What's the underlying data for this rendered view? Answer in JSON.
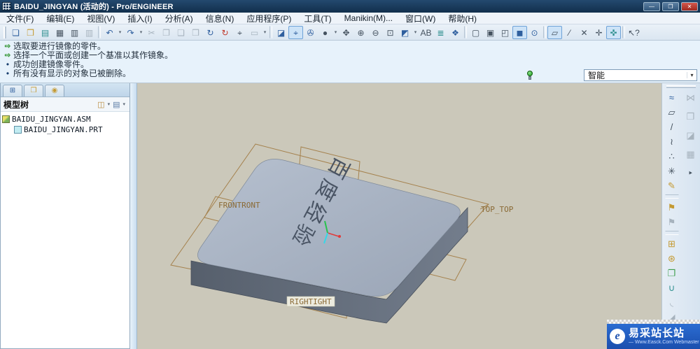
{
  "window": {
    "title": "BAIDU_JINGYAN (活动的) - Pro/ENGINEER",
    "controls": {
      "minimize": "—",
      "restore": "❐",
      "close": "✕"
    }
  },
  "menu": {
    "items": [
      {
        "label": "文件(F)"
      },
      {
        "label": "编辑(E)"
      },
      {
        "label": "视图(V)"
      },
      {
        "label": "插入(I)"
      },
      {
        "label": "分析(A)"
      },
      {
        "label": "信息(N)"
      },
      {
        "label": "应用程序(P)"
      },
      {
        "label": "工具(T)"
      },
      {
        "label": "Manikin(M)..."
      },
      {
        "label": "窗口(W)"
      },
      {
        "label": "帮助(H)"
      }
    ]
  },
  "toolbar": {
    "items": [
      {
        "name": "new-file-icon",
        "glyph": "❏",
        "cls": "t-blue"
      },
      {
        "name": "open-file-icon",
        "glyph": "❒",
        "cls": "t-yellow"
      },
      {
        "name": "save-icon",
        "glyph": "▤",
        "cls": "t-teal"
      },
      {
        "name": "print-icon",
        "glyph": "▦",
        "cls": "t-dark"
      },
      {
        "name": "print-drawing-icon",
        "glyph": "▥",
        "cls": "t-dark"
      },
      {
        "name": "send-model-icon",
        "glyph": "▥",
        "cls": "t-gray"
      },
      {
        "name": "separator",
        "glyph": "",
        "cls": "sep"
      },
      {
        "name": "undo-icon",
        "glyph": "↶",
        "cls": "t-blue"
      },
      {
        "name": "undo-caret-icon",
        "glyph": "▾",
        "cls": "caret"
      },
      {
        "name": "redo-icon",
        "glyph": "↷",
        "cls": "t-blue"
      },
      {
        "name": "redo-caret-icon",
        "glyph": "▾",
        "cls": "caret"
      },
      {
        "name": "cut-icon",
        "glyph": "✂",
        "cls": "t-gray"
      },
      {
        "name": "copy-icon",
        "glyph": "❐",
        "cls": "t-gray"
      },
      {
        "name": "paste-icon",
        "glyph": "❑",
        "cls": "t-gray"
      },
      {
        "name": "paste-special-icon",
        "glyph": "❒",
        "cls": "t-gray"
      },
      {
        "name": "regenerate-icon",
        "glyph": "↻",
        "cls": "t-blue"
      },
      {
        "name": "regenerate-manager-icon",
        "glyph": "↻",
        "cls": "t-red"
      },
      {
        "name": "find-icon",
        "glyph": "⌖",
        "cls": "t-dark"
      },
      {
        "name": "select-box-icon",
        "glyph": "▭",
        "cls": "t-gray"
      },
      {
        "name": "select-caret-icon",
        "glyph": "▾",
        "cls": "caret"
      },
      {
        "name": "separator",
        "glyph": "",
        "cls": "sep"
      },
      {
        "name": "repaint-icon",
        "glyph": "◪",
        "cls": "t-blue"
      },
      {
        "name": "spin-center-icon",
        "glyph": "⌖",
        "cls": "t-blue active"
      },
      {
        "name": "shading-icon",
        "glyph": "✇",
        "cls": "t-blue"
      },
      {
        "name": "render-style-icon",
        "glyph": "●",
        "cls": "t-dark"
      },
      {
        "name": "render-style-caret-icon",
        "glyph": "▾",
        "cls": "caret"
      },
      {
        "name": "pan-zoom-icon",
        "glyph": "✥",
        "cls": "t-dark"
      },
      {
        "name": "zoom-in-icon",
        "glyph": "⊕",
        "cls": "t-dark"
      },
      {
        "name": "zoom-out-icon",
        "glyph": "⊖",
        "cls": "t-dark"
      },
      {
        "name": "refit-icon",
        "glyph": "⊡",
        "cls": "t-dark"
      },
      {
        "name": "reorient-icon",
        "glyph": "◩",
        "cls": "t-blue"
      },
      {
        "name": "reorient-caret-icon",
        "glyph": "▾",
        "cls": "caret"
      },
      {
        "name": "saved-views-icon",
        "glyph": "AB",
        "cls": "t-dark"
      },
      {
        "name": "layers-icon",
        "glyph": "≣",
        "cls": "t-teal"
      },
      {
        "name": "view-manager-icon",
        "glyph": "❖",
        "cls": "t-blue"
      },
      {
        "name": "separator",
        "glyph": "",
        "cls": "sep"
      },
      {
        "name": "wireframe-icon",
        "glyph": "▢",
        "cls": "t-dark"
      },
      {
        "name": "hidden-line-icon",
        "glyph": "▣",
        "cls": "t-dark"
      },
      {
        "name": "no-hidden-icon",
        "glyph": "◰",
        "cls": "t-dark"
      },
      {
        "name": "shaded-display-icon",
        "glyph": "◼",
        "cls": "t-blue active"
      },
      {
        "name": "datum-pin-icon",
        "glyph": "⊙",
        "cls": "t-blue"
      },
      {
        "name": "separator",
        "glyph": "",
        "cls": "sep"
      },
      {
        "name": "plane-display-icon",
        "glyph": "▱",
        "cls": "t-dark active"
      },
      {
        "name": "axis-display-icon",
        "glyph": "⁄",
        "cls": "t-dark"
      },
      {
        "name": "point-display-icon",
        "glyph": "✕",
        "cls": "t-dark"
      },
      {
        "name": "csys-display-icon",
        "glyph": "✛",
        "cls": "t-dark"
      },
      {
        "name": "spin-center-display-icon",
        "glyph": "✜",
        "cls": "t-teal active"
      },
      {
        "name": "separator",
        "glyph": "",
        "cls": "sep"
      },
      {
        "name": "context-help-icon",
        "glyph": "↖?",
        "cls": "t-dark"
      }
    ]
  },
  "messages": {
    "lines": [
      {
        "icon": "arrow",
        "glyph": "⇨",
        "text": "选取要进行镜像的零件。"
      },
      {
        "icon": "arrow",
        "glyph": "⇨",
        "text": "选择一个平面或创建一个基准以其作镜象。"
      },
      {
        "icon": "dot",
        "glyph": "•",
        "text": "成功创建镜像零件。"
      },
      {
        "icon": "dot",
        "glyph": "•",
        "text": "所有没有显示的对象已被删除。"
      }
    ]
  },
  "filter": {
    "label": "智能"
  },
  "left_panel": {
    "tabs": [
      {
        "name": "tab-model-tree",
        "glyph": "⊞",
        "cls": "g1 active"
      },
      {
        "name": "tab-folder-browser",
        "glyph": "❒",
        "cls": "g2"
      },
      {
        "name": "tab-favorites",
        "glyph": "◉",
        "cls": "g3"
      }
    ],
    "title": "模型树",
    "show_tool": "◫",
    "settings_tool": "▤",
    "caret": "▾",
    "tree": [
      {
        "label": "BAIDU_JINGYAN.ASM",
        "icon": "asm",
        "cls": "lvl0"
      },
      {
        "label": "BAIDU_JINGYAN.PRT",
        "icon": "prt",
        "cls": "lvl1"
      }
    ]
  },
  "viewport": {
    "labels": {
      "front": "FRONTRONT",
      "top": "TOP_TOP",
      "right": "RIGHTIGHT"
    },
    "engraved_text": "百度经验",
    "colors": {
      "background": "#cbc8ba",
      "datum": "#a5824e",
      "top_face": "#aab4c4",
      "side_face": "#626c7a"
    }
  },
  "right_toolbar": {
    "primary": [
      {
        "name": "curve-through-points-icon",
        "glyph": "≈",
        "cls": "t-blue"
      },
      {
        "name": "datum-plane-icon",
        "glyph": "▱",
        "cls": "t-dark"
      },
      {
        "name": "datum-axis-icon",
        "glyph": "/",
        "cls": "t-dark"
      },
      {
        "name": "datum-curve-icon",
        "glyph": "≀",
        "cls": "t-dark"
      },
      {
        "name": "datum-point-icon",
        "glyph": "∴",
        "cls": "t-dark"
      },
      {
        "name": "datum-csys-icon",
        "glyph": "✳",
        "cls": "t-dark"
      },
      {
        "name": "sketch-icon",
        "glyph": "✎",
        "cls": "t-yellow"
      },
      {
        "name": "separator",
        "glyph": "",
        "cls": "sep"
      },
      {
        "name": "annotation-icon",
        "glyph": "⚑",
        "cls": "t-yellow"
      },
      {
        "name": "annotation-alt-icon",
        "glyph": "⚑",
        "cls": "t-gray"
      },
      {
        "name": "separator",
        "glyph": "",
        "cls": "sep"
      },
      {
        "name": "assemble-component-icon",
        "glyph": "⊞",
        "cls": "t-yellow"
      },
      {
        "name": "create-component-icon",
        "glyph": "⊛",
        "cls": "t-yellow"
      },
      {
        "name": "package-component-icon",
        "glyph": "❐",
        "cls": "t-green"
      },
      {
        "name": "shell-icon",
        "glyph": "∪",
        "cls": "t-teal"
      },
      {
        "name": "round-icon",
        "glyph": "◟",
        "cls": "t-gray"
      },
      {
        "name": "chamfer-icon",
        "glyph": "◢",
        "cls": "t-gray"
      }
    ],
    "secondary": [
      {
        "name": "mirror-component-icon",
        "glyph": "⋈",
        "cls": "t-gray"
      },
      {
        "name": "copy-geometry-icon",
        "glyph": "❒",
        "cls": "t-gray"
      },
      {
        "name": "cut-geometry-icon",
        "glyph": "◪",
        "cls": "t-gray"
      },
      {
        "name": "grid-icon",
        "glyph": "▦",
        "cls": "t-gray"
      },
      {
        "name": "flyout-arrow-icon",
        "glyph": "‣",
        "cls": "t-dark"
      }
    ]
  },
  "watermark": {
    "brand": "易采站长站",
    "tagline": "— Www.Easck.Com Webmaster",
    "logo_letter": "e"
  }
}
